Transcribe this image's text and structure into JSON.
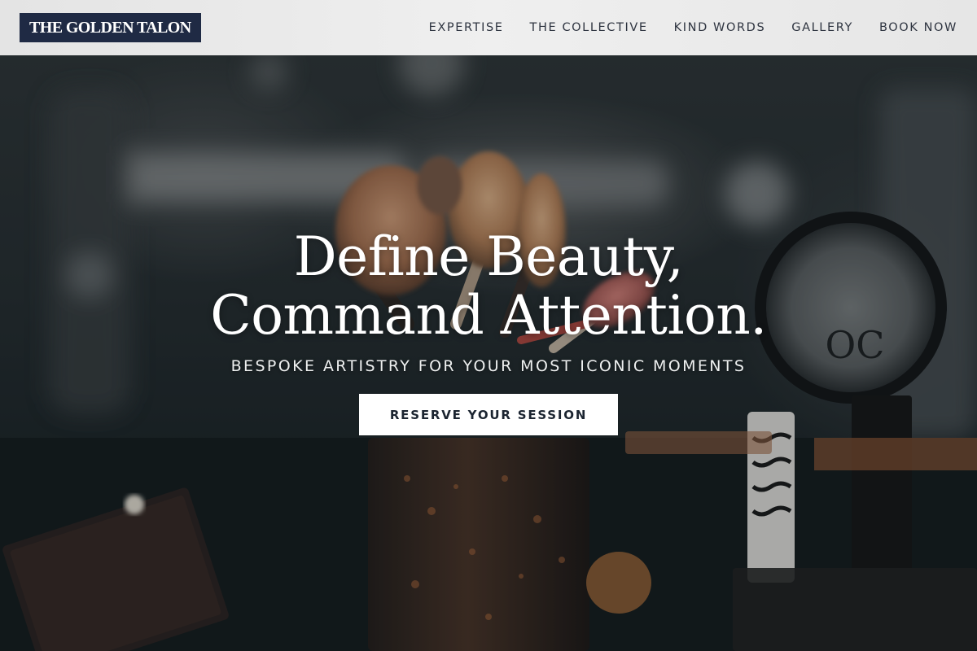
{
  "brand": {
    "logo_text": "THE GOLDEN TALON"
  },
  "nav": {
    "items": [
      {
        "label": "EXPERTISE"
      },
      {
        "label": "THE COLLECTIVE"
      },
      {
        "label": "KIND WORDS"
      },
      {
        "label": "GALLERY"
      },
      {
        "label": "BOOK NOW"
      }
    ]
  },
  "hero": {
    "headline_line1": "Define Beauty,",
    "headline_line2": "Command Attention.",
    "subheadline": "BESPOKE ARTISTRY FOR YOUR MOST ICONIC MOMENTS",
    "cta_label": "RESERVE YOUR SESSION",
    "background_image": "makeup-brushes-photo"
  },
  "colors": {
    "logo_bg": "#1f2a44",
    "header_bg": "#e9e9e9",
    "nav_text": "#2e3440",
    "cta_bg": "#ffffff",
    "cta_text": "#1b2430",
    "hero_text": "#ffffff"
  }
}
